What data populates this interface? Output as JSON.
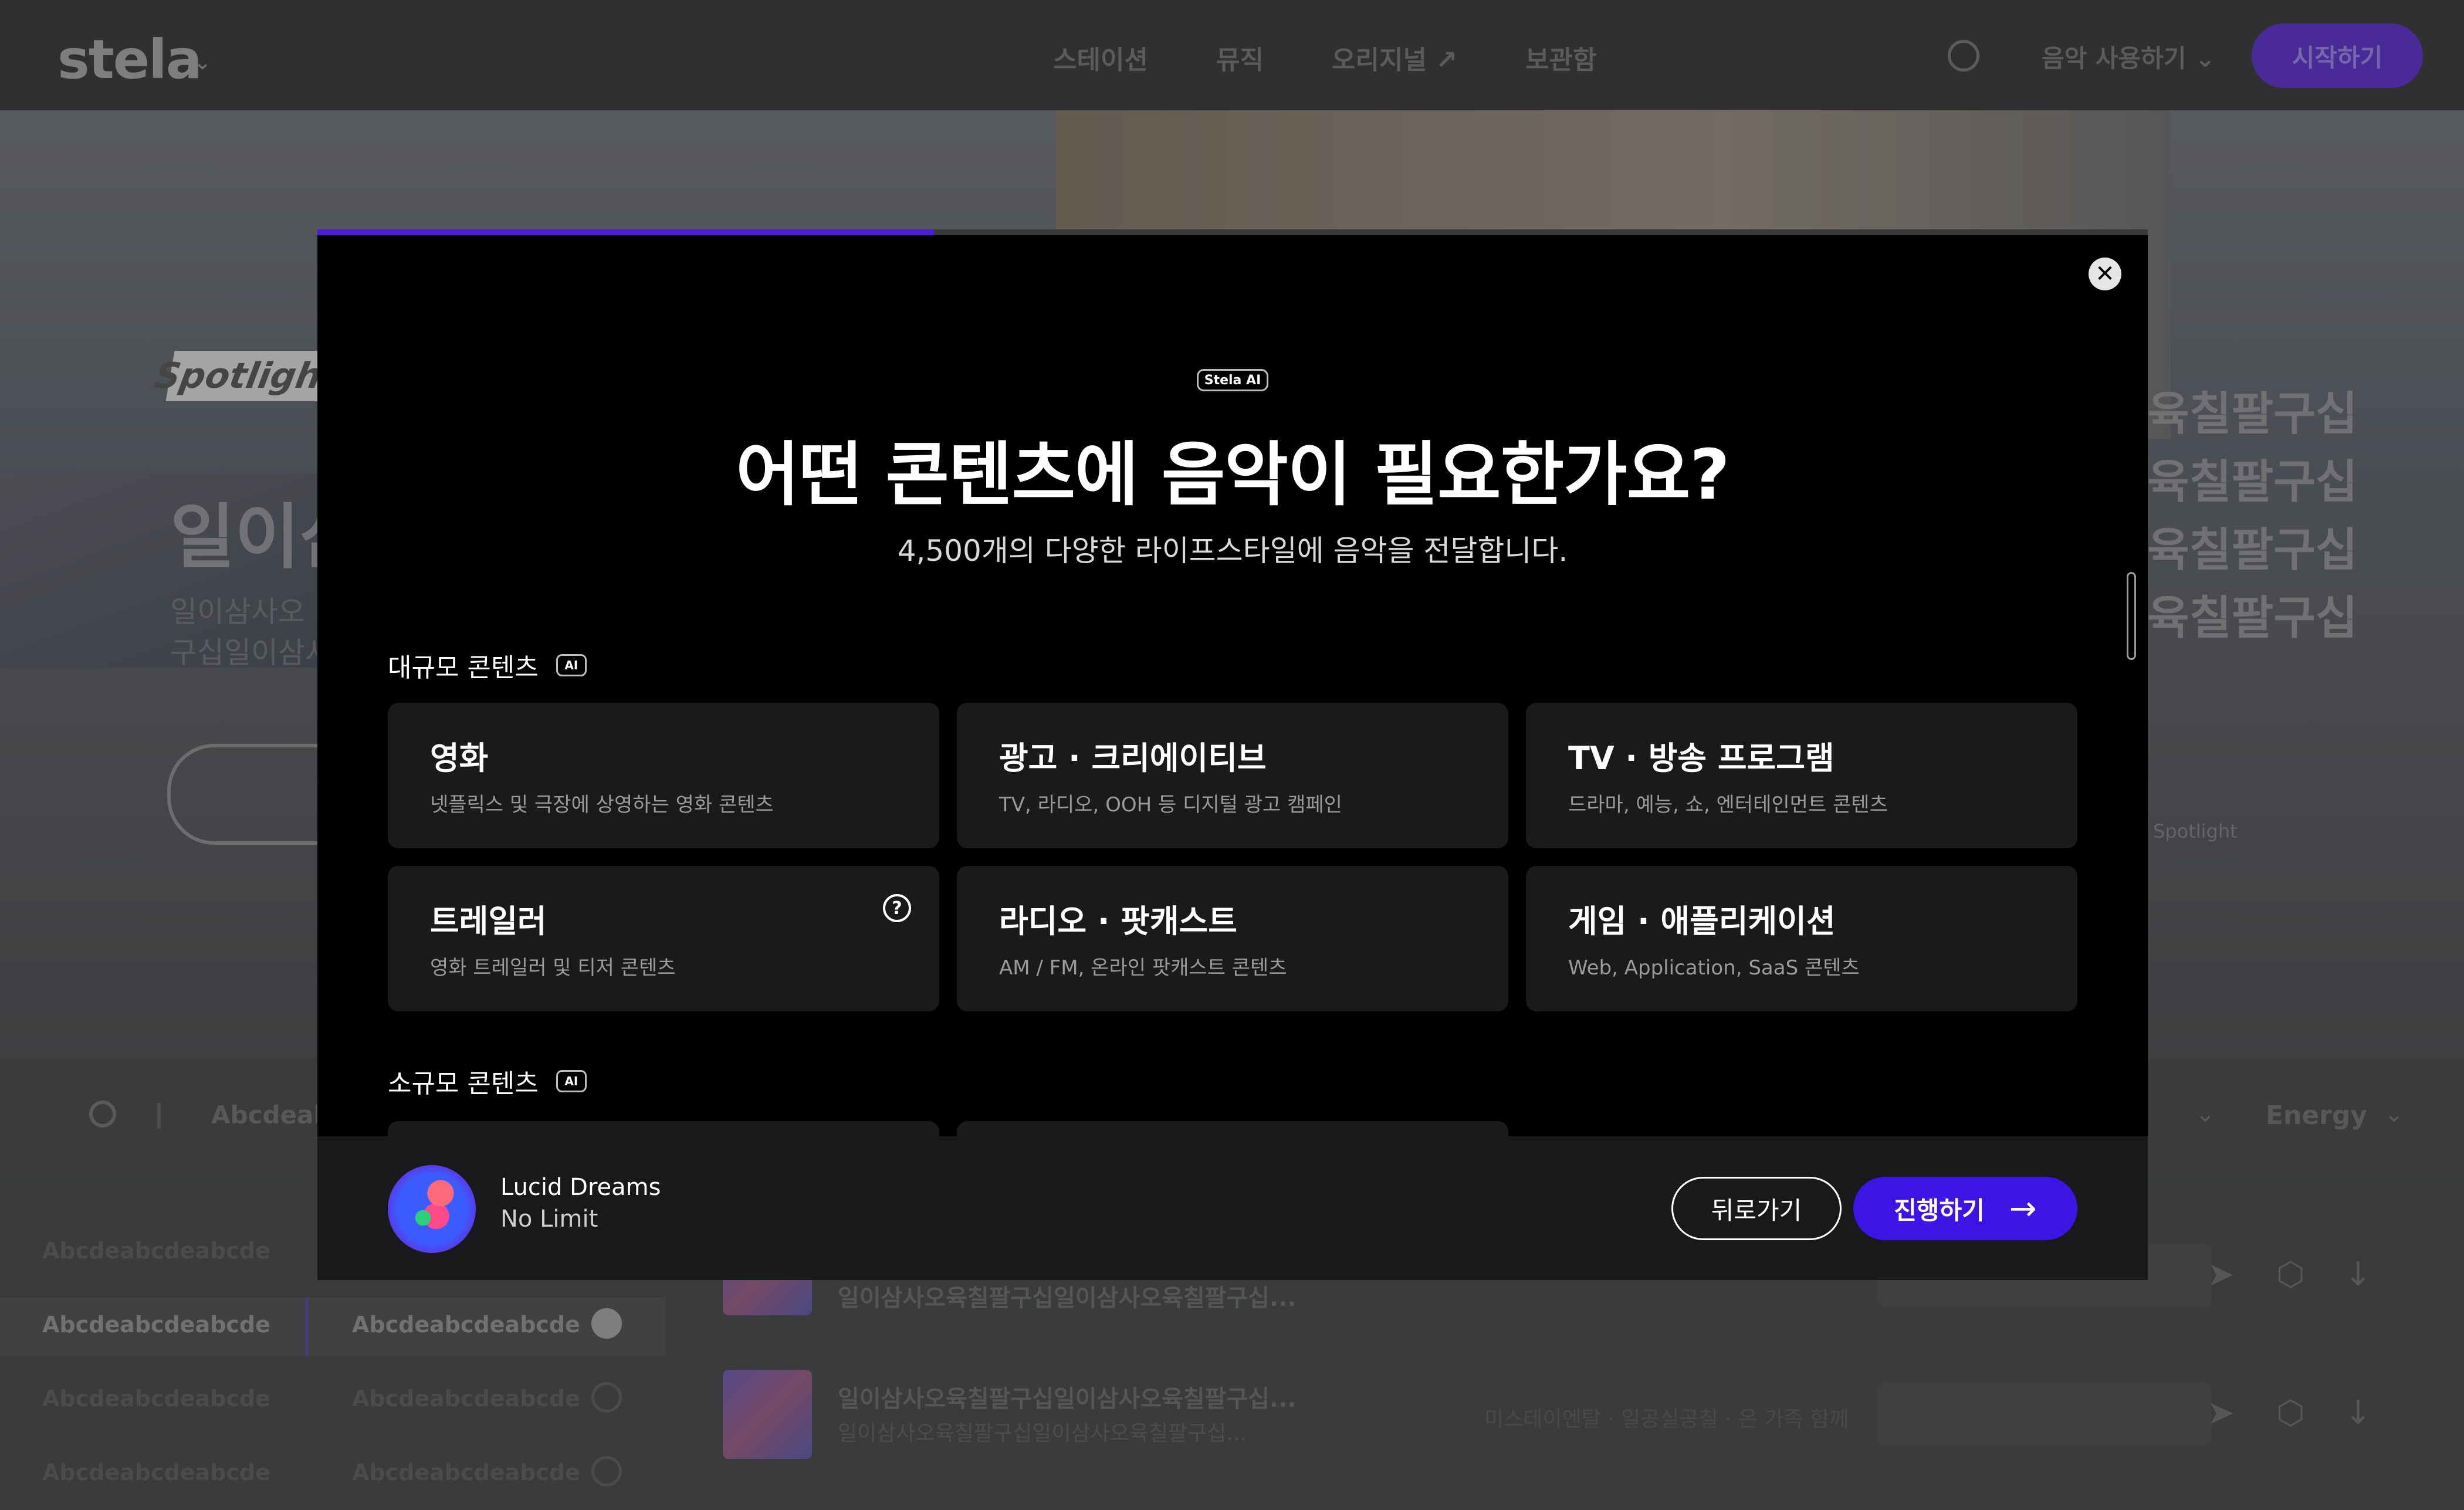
{
  "background": {
    "logo": "stela",
    "nav": [
      "스테이션",
      "뮤직",
      "오리지널 ↗",
      "보관함"
    ],
    "util_label": "음악 사용하기 ⌄",
    "start_button": "시작하기",
    "hero": {
      "tag": "Spotlight",
      "title": "일이삼",
      "sub_lines": [
        "일이삼사오",
        "구십일이삼사"
      ],
      "right_lines": [
        "육칠팔구십",
        "육칠팔구십",
        "육칠팔구십",
        "육칠팔구십"
      ],
      "small": "Spotlight"
    },
    "filter": {
      "text": "Abcdeab",
      "energy": "Energy"
    },
    "genres": [
      "Abcdeabcdeabcde",
      "Abcdeabcdeabcde",
      "Abcdeabcdeabcde",
      "Abcdeabcdeabcde"
    ],
    "subgenres": [
      "Abcdeabcdeabcde",
      "Abcdeabcdeabcde",
      "Abcdeabcdeabcde"
    ],
    "tracks": [
      {
        "title": "일이삼사오육칠팔구십일이삼사오육칠팔구십...",
        "sub": ""
      },
      {
        "title": "일이삼사오육칠팔구십일이삼사오육칠팔구십...",
        "sub": "일이삼사오육칠팔구십일이삼사오육칠팔구십...",
        "meta": "미스테이엔탈 · 일공실공칠 · 온 가족 함께"
      }
    ]
  },
  "modal": {
    "progress_percent": 33.7,
    "badge": "Stela AI",
    "title": "어떤 콘텐츠에 음악이 필요한가요?",
    "subtitle": "4,500개의 다양한 라이프스타일에 음악을 전달합니다.",
    "sections": [
      {
        "label": "대규모 콘텐츠",
        "chip": "AI",
        "cards": [
          {
            "title": "영화",
            "desc": "넷플릭스 및 극장에 상영하는 영화 콘텐츠"
          },
          {
            "title": "광고 · 크리에이티브",
            "desc": "TV, 라디오, OOH 등 디지털 광고 캠페인"
          },
          {
            "title": "TV · 방송 프로그램",
            "desc": "드라마, 예능, 쇼, 엔터테인먼트 콘텐츠"
          },
          {
            "title": "트레일러",
            "desc": "영화 트레일러 및 티저 콘텐츠"
          },
          {
            "title": "라디오 · 팟캐스트",
            "desc": "AM / FM, 온라인 팟캐스트 콘텐츠"
          },
          {
            "title": "게임 · 애플리케이션",
            "desc": "Web, Application, SaaS 콘텐츠"
          }
        ]
      },
      {
        "label": "소규모 콘텐츠",
        "chip": "AI"
      }
    ],
    "footer": {
      "song": "Lucid Dreams",
      "artist": "No Limit",
      "back_label": "뒤로가기",
      "next_label": "진행하기"
    },
    "icons": {
      "close": "close-icon",
      "help": "help-circle-icon",
      "arrow": "arrow-right-icon"
    },
    "accent_color": "#3d14e6"
  }
}
